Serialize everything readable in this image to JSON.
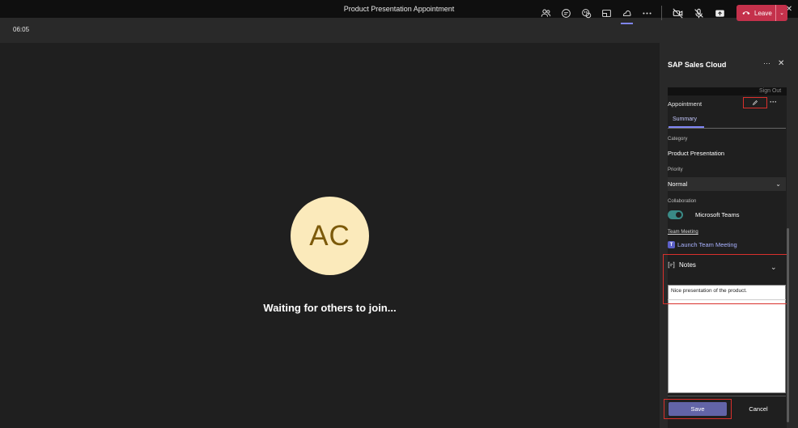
{
  "window": {
    "title": "Product Presentation Appointment",
    "controls": {
      "minimize": "—",
      "restore": "❐",
      "close": "✕"
    }
  },
  "toolbar": {
    "timer": "06:05",
    "icons": [
      "people-icon",
      "chat-icon",
      "reactions-icon",
      "share-tray-icon",
      "apps-icon",
      "more-icon",
      "camera-off-icon",
      "mic-off-icon",
      "share-icon"
    ],
    "leave_label": "Leave",
    "leave_color": "#c4314b"
  },
  "stage": {
    "avatar_initials": "AC",
    "status": "Waiting for others to join..."
  },
  "panel": {
    "title": "SAP Sales Cloud",
    "sign_out": "Sign Out",
    "record_type": "Appointment",
    "tab": "Summary",
    "category_label": "Category",
    "category_value": "Product Presentation",
    "priority_label": "Priority",
    "priority_value": "Normal",
    "collaboration_label": "Collaboration",
    "collaboration_value": "Microsoft Teams",
    "collaboration_enabled": true,
    "team_meeting_label": "Team Meeting",
    "launch_link": "Launch Team Meeting",
    "notes_title": "Notes",
    "notes_text": "Nice presentation of the product.",
    "save_label": "Save",
    "cancel_label": "Cancel",
    "accent": "#6264a7",
    "highlight_color": "#d9302c"
  }
}
